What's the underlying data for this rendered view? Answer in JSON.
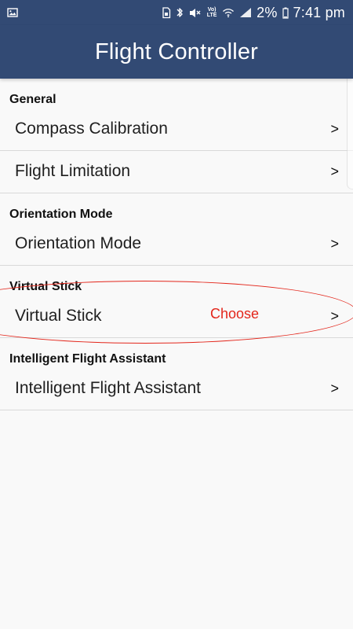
{
  "status_bar": {
    "time": "7:41 pm",
    "battery": "2%",
    "network_label_top": "Vo)",
    "network_label_bottom": "LTE",
    "icons": [
      "image-icon",
      "sim-icon",
      "bluetooth-icon",
      "mute-icon",
      "wifi-icon",
      "signal-icon",
      "battery-icon"
    ]
  },
  "header": {
    "title": "Flight Controller"
  },
  "sections": [
    {
      "header": "General",
      "items": [
        {
          "label": "Compass Calibration",
          "arrow": ">"
        },
        {
          "label": "Flight Limitation",
          "arrow": ">"
        }
      ]
    },
    {
      "header": "Orientation Mode",
      "items": [
        {
          "label": "Orientation Mode",
          "arrow": ">"
        }
      ]
    },
    {
      "header": "Virtual Stick",
      "items": [
        {
          "label": "Virtual Stick",
          "arrow": ">"
        }
      ]
    },
    {
      "header": "Intelligent Flight Assistant",
      "items": [
        {
          "label": "Intelligent Flight Assistant",
          "arrow": ">"
        }
      ]
    }
  ],
  "annotation": {
    "label": "Choose",
    "color": "#e3261b"
  },
  "colors": {
    "header_background": "#324a74",
    "page_background": "#f9f9f9",
    "divider": "#d9d9d9"
  }
}
